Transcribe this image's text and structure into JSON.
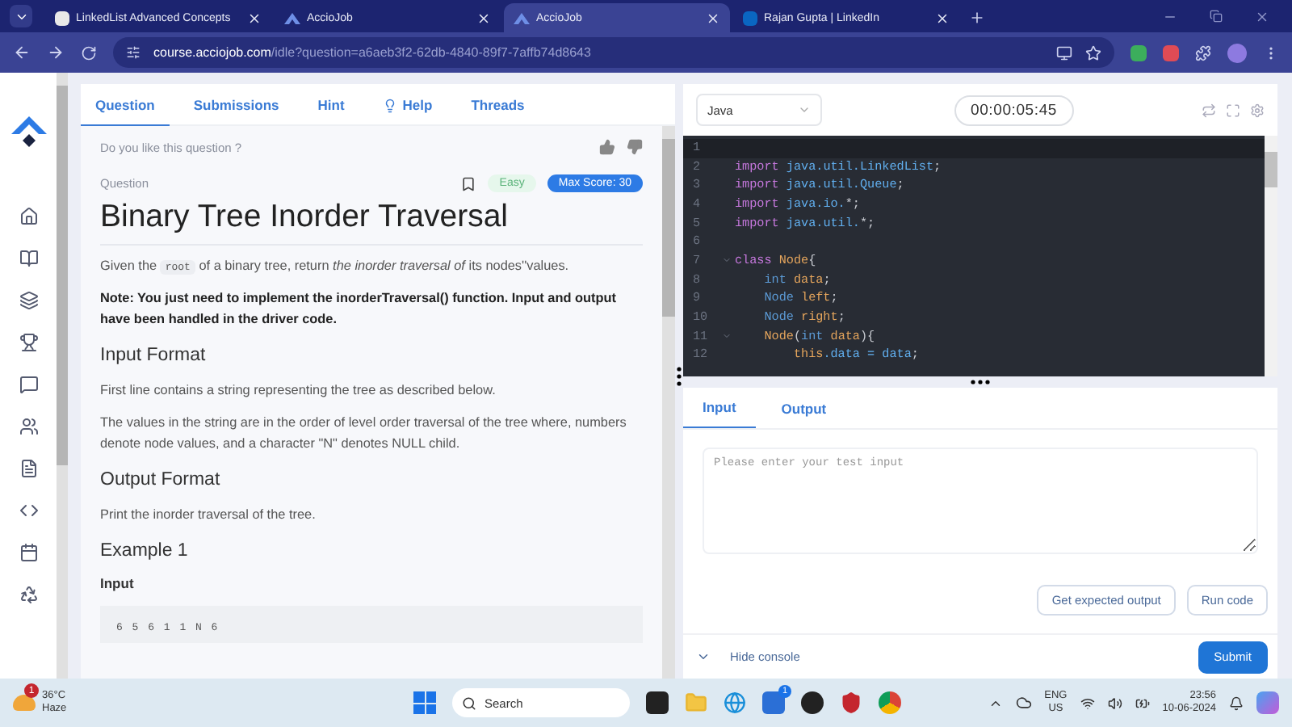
{
  "browser": {
    "tabs": [
      {
        "title": "LinkedList Advanced Concepts",
        "selected": false
      },
      {
        "title": "AccioJob",
        "selected": false
      },
      {
        "title": "AccioJob",
        "selected": true
      },
      {
        "title": "Rajan Gupta | LinkedIn",
        "selected": false
      }
    ],
    "url": {
      "domain": "course.acciojob.com",
      "path": "/idle?question=a6aeb3f2-62db-4840-89f7-7affb74d8643"
    }
  },
  "question_tabs": [
    {
      "label": "Question",
      "selected": true
    },
    {
      "label": "Submissions",
      "selected": false
    },
    {
      "label": "Hint",
      "selected": false
    },
    {
      "label": "Help",
      "selected": false
    },
    {
      "label": "Threads",
      "selected": false
    }
  ],
  "feedback_prompt": "Do you like this question ?",
  "question": {
    "label": "Question",
    "difficulty": "Easy",
    "max_score": "Max Score: 30",
    "bookmarked": false,
    "title": "Binary Tree Inorder Traversal",
    "blocks": [
      {
        "kind": "intro",
        "before": "Given the",
        "code": "root",
        "after": "of a binary tree, return *the inorder traversal of* its nodes''values."
      },
      {
        "kind": "note",
        "text": "Note: You just need to implement the inorderTraversal() function. Input and output have been handled in the driver code."
      },
      {
        "kind": "heading",
        "text": "Input Format"
      },
      {
        "kind": "paragraph",
        "text": "First line contains a string representing the tree as described below."
      },
      {
        "kind": "paragraph",
        "text": "The values in the string are in the order of level order traversal of the tree where, numbers denote node values, and a character \"N\" denotes NULL child."
      },
      {
        "kind": "heading",
        "text": "Output Format"
      },
      {
        "kind": "paragraph",
        "text": "Print the inorder traversal of the tree."
      },
      {
        "kind": "heading",
        "text": "Example 1"
      },
      {
        "kind": "label",
        "text": "Input"
      },
      {
        "kind": "sample",
        "text": "6 5 6 1 1 N 6"
      }
    ]
  },
  "editor": {
    "language": "Java",
    "timer": "00:00:05:45",
    "lines": [
      {
        "number": "1",
        "fold": false,
        "current": true
      },
      {
        "number": "2",
        "fold": false,
        "current": false,
        "tokens": [
          {
            "t": "import ",
            "kind": "keyword"
          },
          {
            "t": "java.util.LinkedList",
            "kind": "package"
          },
          {
            "t": ";",
            "kind": "punct"
          }
        ]
      },
      {
        "number": "3",
        "fold": false,
        "current": false,
        "tokens": [
          {
            "t": "import ",
            "kind": "keyword"
          },
          {
            "t": "java.util.Queue",
            "kind": "package"
          },
          {
            "t": ";",
            "kind": "punct"
          }
        ]
      },
      {
        "number": "4",
        "fold": false,
        "current": false,
        "tokens": [
          {
            "t": "import ",
            "kind": "keyword"
          },
          {
            "t": "java.io.",
            "kind": "package"
          },
          {
            "t": "*;",
            "kind": "punct"
          }
        ]
      },
      {
        "number": "5",
        "fold": false,
        "current": false,
        "tokens": [
          {
            "t": "import ",
            "kind": "keyword"
          },
          {
            "t": "java.util.",
            "kind": "package"
          },
          {
            "t": "*;",
            "kind": "punct"
          }
        ]
      },
      {
        "number": "6",
        "fold": false,
        "current": false
      },
      {
        "number": "7",
        "fold": true,
        "current": false,
        "tokens": [
          {
            "t": "class ",
            "kind": "keyword"
          },
          {
            "t": "Node",
            "kind": "name"
          },
          {
            "t": "{",
            "kind": "punct"
          }
        ]
      },
      {
        "number": "8",
        "fold": false,
        "current": false,
        "tokens": [
          {
            "t": "    int ",
            "kind": "type"
          },
          {
            "t": "data",
            "kind": "name"
          },
          {
            "t": ";",
            "kind": "punct"
          }
        ]
      },
      {
        "number": "9",
        "fold": false,
        "current": false,
        "tokens": [
          {
            "t": "    Node ",
            "kind": "type"
          },
          {
            "t": "left",
            "kind": "name"
          },
          {
            "t": ";",
            "kind": "punct"
          }
        ]
      },
      {
        "number": "10",
        "fold": false,
        "current": false,
        "tokens": [
          {
            "t": "    Node ",
            "kind": "type"
          },
          {
            "t": "right",
            "kind": "name"
          },
          {
            "t": ";",
            "kind": "punct"
          }
        ]
      },
      {
        "number": "11",
        "fold": true,
        "current": false,
        "tokens": [
          {
            "t": "    Node",
            "kind": "name"
          },
          {
            "t": "(",
            "kind": "punct"
          },
          {
            "t": "int ",
            "kind": "type"
          },
          {
            "t": "data",
            "kind": "name"
          },
          {
            "t": "){",
            "kind": "punct"
          }
        ]
      },
      {
        "number": "12",
        "fold": false,
        "current": false,
        "tokens": [
          {
            "t": "        this",
            "kind": "name"
          },
          {
            "t": ".data = ",
            "kind": "package"
          },
          {
            "t": "data",
            "kind": "package"
          },
          {
            "t": ";",
            "kind": "punct"
          }
        ]
      }
    ]
  },
  "console": {
    "tabs": [
      {
        "label": "Input",
        "selected": true
      },
      {
        "label": "Output",
        "selected": false
      }
    ],
    "placeholder": "Please enter your test input",
    "buttons": [
      "Get expected output",
      "Run code"
    ],
    "toggle": "Hide console",
    "submit": "Submit"
  },
  "taskbar": {
    "weather": {
      "temp": "36°C",
      "condition": "Haze",
      "badge": "1"
    },
    "search": "Search",
    "store_badge": "1",
    "language": "ENG",
    "region": "US",
    "time": "23:56",
    "date": "10-06-2024"
  }
}
